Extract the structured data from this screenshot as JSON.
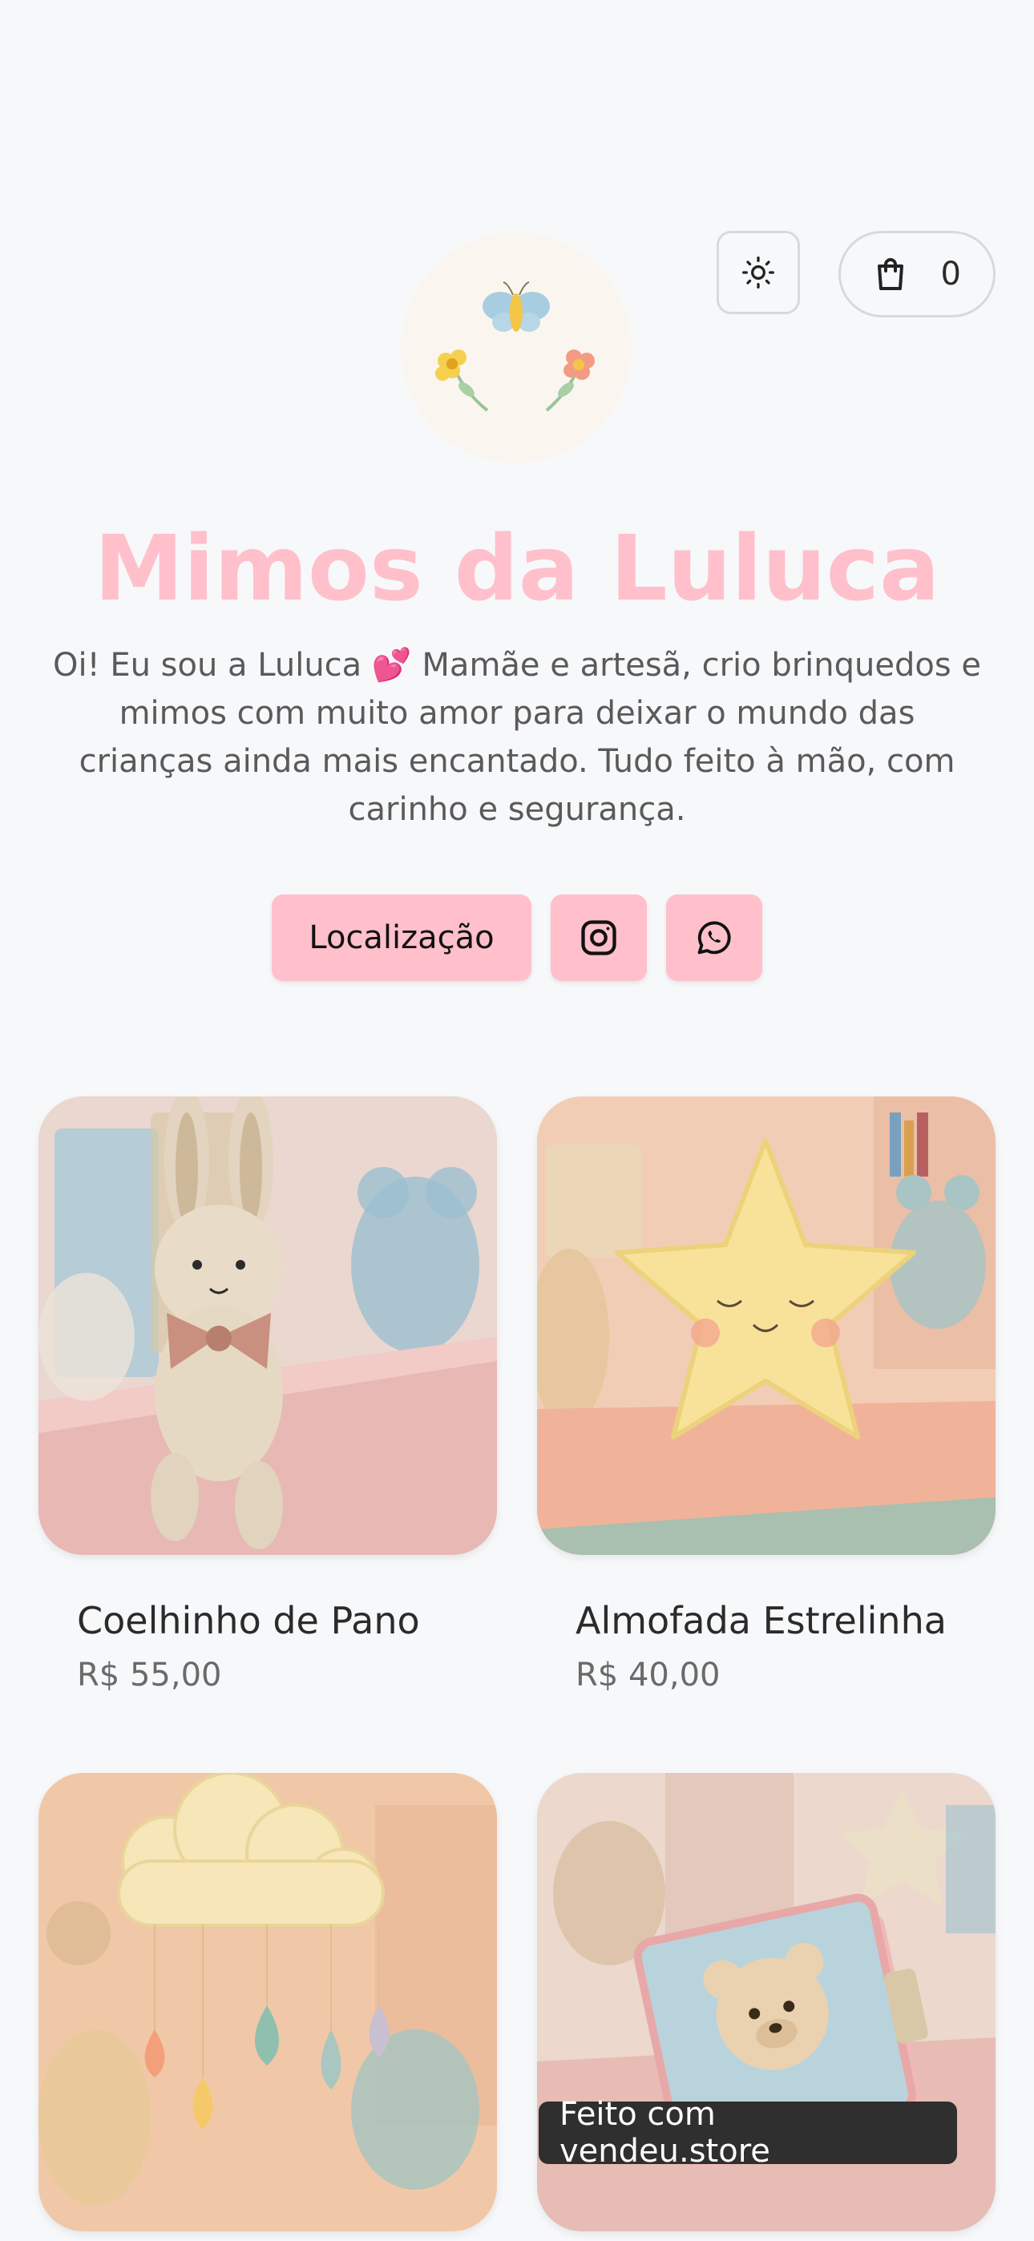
{
  "header": {
    "cart_count": "0",
    "icons": {
      "theme": "sun-icon",
      "cart": "shopping-bag-icon"
    }
  },
  "store": {
    "name": "Mimos da Luluca",
    "bio": "Oi! Eu sou a Luluca 💕 Mamãe e artesã, crio brinquedos e mimos com muito amor para deixar o mundo das crianças ainda mais encantado. Tudo feito à mão, com carinho e segurança."
  },
  "links": {
    "location_label": "Localização",
    "icons": [
      "instagram-icon",
      "whatsapp-icon"
    ]
  },
  "products": [
    {
      "name": "Coelhinho de Pano",
      "price": "R$ 55,00"
    },
    {
      "name": "Almofada Estrelinha",
      "price": "R$ 40,00"
    },
    {
      "name": "",
      "price": ""
    },
    {
      "name": "",
      "price": ""
    }
  ],
  "footer": {
    "badge": "Feito com vendeu.store"
  },
  "colors": {
    "accent": "#ffc0cb",
    "background": "#f7f8fa"
  }
}
